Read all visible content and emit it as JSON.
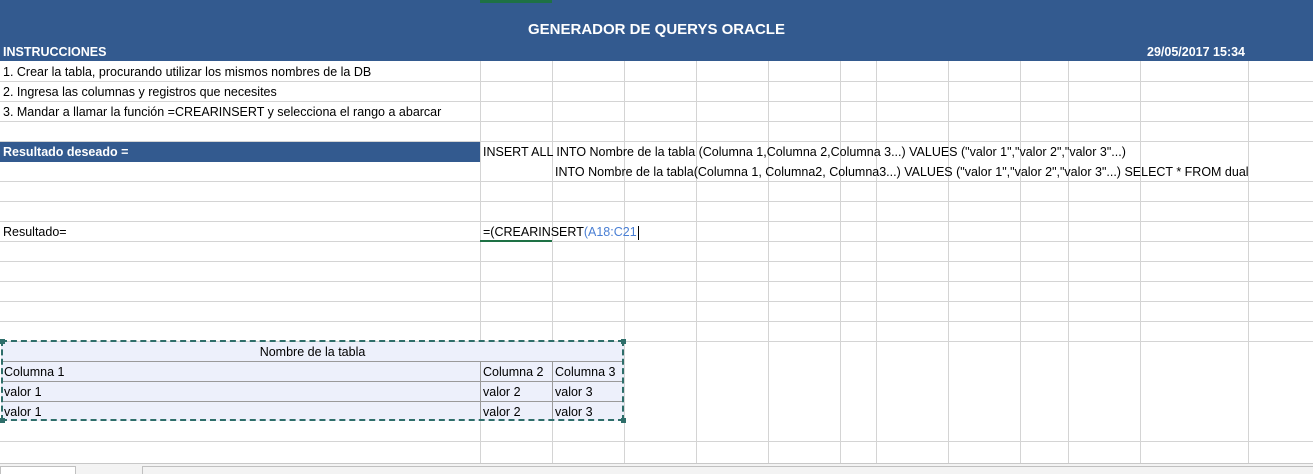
{
  "header": {
    "title": "GENERADOR DE QUERYS ORACLE",
    "instructions_label": "INSTRUCCIONES",
    "datetime": "29/05/2017 15:34"
  },
  "instructions": [
    "1. Crear la tabla, procurando utilizar los mismos nombres de la DB",
    "2. Ingresa las columnas y registros que necesites",
    "3. Mandar a llamar la función =CREARINSERT y selecciona el rango a abarcar"
  ],
  "desired": {
    "label": "Resultado deseado =",
    "line1": "INSERT ALL INTO Nombre de la tabla (Columna 1,Columna 2,Columna 3...) VALUES (\"valor 1\",\"valor 2\",\"valor 3\"...)",
    "line2": "INTO Nombre de la tabla(Columna 1, Columna2, Columna3...) VALUES (\"valor 1\",\"valor 2\",\"valor 3\"...) SELECT * FROM dual"
  },
  "result": {
    "label": "Resultado=",
    "formula_prefix": "=(CREARINSERT",
    "formula_args": "(A18:C21"
  },
  "table": {
    "name": "Nombre de la tabla",
    "columns": [
      "Columna 1",
      "Columna 2",
      "Columna 3"
    ],
    "rows": [
      [
        "valor 1",
        "valor 2",
        "valor 3"
      ],
      [
        "valor 1",
        "valor 2",
        "valor 3"
      ]
    ]
  },
  "colors": {
    "header_band": "#335a8f",
    "table_fill": "#edf0fb",
    "formula_ref": "#4a7fd4",
    "selection": "#2e6e6a"
  }
}
